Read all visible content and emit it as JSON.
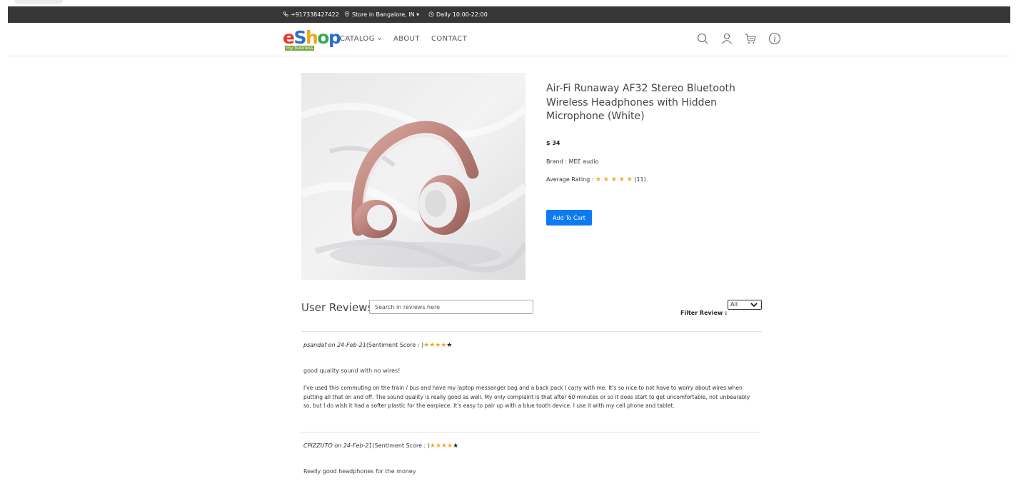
{
  "topbar": {
    "phone": "+917338427422",
    "store": "Store in Bangalore, IN ▾",
    "hours": "Daily 10:00-22:00"
  },
  "nav": {
    "logo_e": "e",
    "logo_s": "S",
    "logo_h": "h",
    "logo_o": "o",
    "logo_p": "p",
    "logo_tagline": "my business",
    "catalog": "CATALOG",
    "about": "ABOUT",
    "contact": "CONTACT",
    "icons": [
      "search-icon",
      "user-icon",
      "cart-icon",
      "info-icon"
    ]
  },
  "product": {
    "title": "Air-Fi Runaway AF32 Stereo Bluetooth Wireless Headphones with Hidden Microphone (White)",
    "price": "$ 34",
    "brand": "Brand : MEE audio",
    "rating_label": "Average Rating :",
    "rating_stars": "★ ★ ★ ★ ★",
    "rating_count": "(11)",
    "add_to_cart": "Add To Cart"
  },
  "reviews": {
    "heading": "User Reviews",
    "search_placeholder": "Search in reviews here",
    "filter_label": "Filter Review :",
    "filter_value": "All",
    "items": [
      {
        "author_date": "psandaf on 24-Feb-21",
        "sentiment": "(Sentiment Score : )",
        "stars_gold": "★★★★",
        "stars_dark": "★",
        "title": "good quality sound with no wires!",
        "body": "I've used this commuting on the train / bus and have my laptop messenger bag and a back pack I carry with me. It's so nice to not have to worry about wires when putting all that on and off. The sound quality is really good as well. My only complaint is that after 60 minutes or so it does start to get uncomfortable, not unbearably so, but I do wish it had a softer plastic for the earpiece. It's easy to pair up with a blue tooth device. I use it with my cell phone and tablet."
      },
      {
        "author_date": "CPIZZUTO on 24-Feb-21",
        "sentiment": "(Sentiment Score : )",
        "stars_gold": "★★★★",
        "stars_dark": "★",
        "title": "Really good headphones for the money"
      }
    ]
  },
  "colors": {
    "topbar": "#363636",
    "accent": "#0d7af2",
    "star": "#f5a623"
  }
}
